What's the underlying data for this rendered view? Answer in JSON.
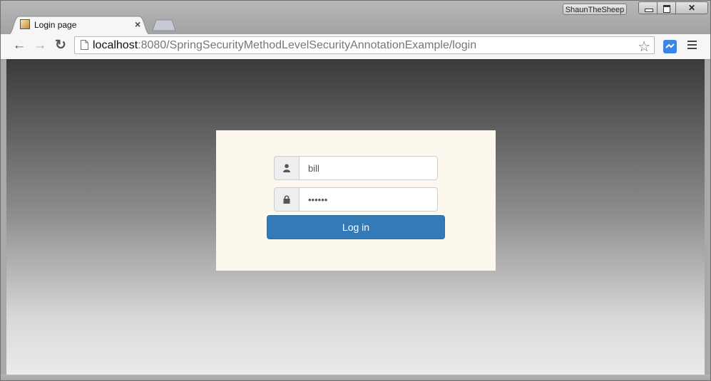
{
  "window": {
    "profile_name": "ShaunTheSheep"
  },
  "tabs": [
    {
      "title": "Login page",
      "active": true
    }
  ],
  "toolbar": {
    "url_host": "localhost",
    "url_rest": ":8080/SpringSecurityMethodLevelSecurityAnnotationExample/login"
  },
  "icons": {
    "back": "back-arrow-icon",
    "forward": "forward-arrow-icon",
    "reload": "reload-icon",
    "page": "page-icon",
    "bookmark": "star-icon",
    "extension": "extension-icon",
    "menu": "hamburger-menu-icon",
    "user": "user-icon",
    "lock": "lock-icon"
  },
  "login": {
    "username_value": "bill",
    "password_value": "abc123",
    "submit_label": "Log in"
  },
  "colors": {
    "primary_button": "#337ab7",
    "card_background": "#fdf8ee",
    "extension_icon": "#3b85e6"
  }
}
